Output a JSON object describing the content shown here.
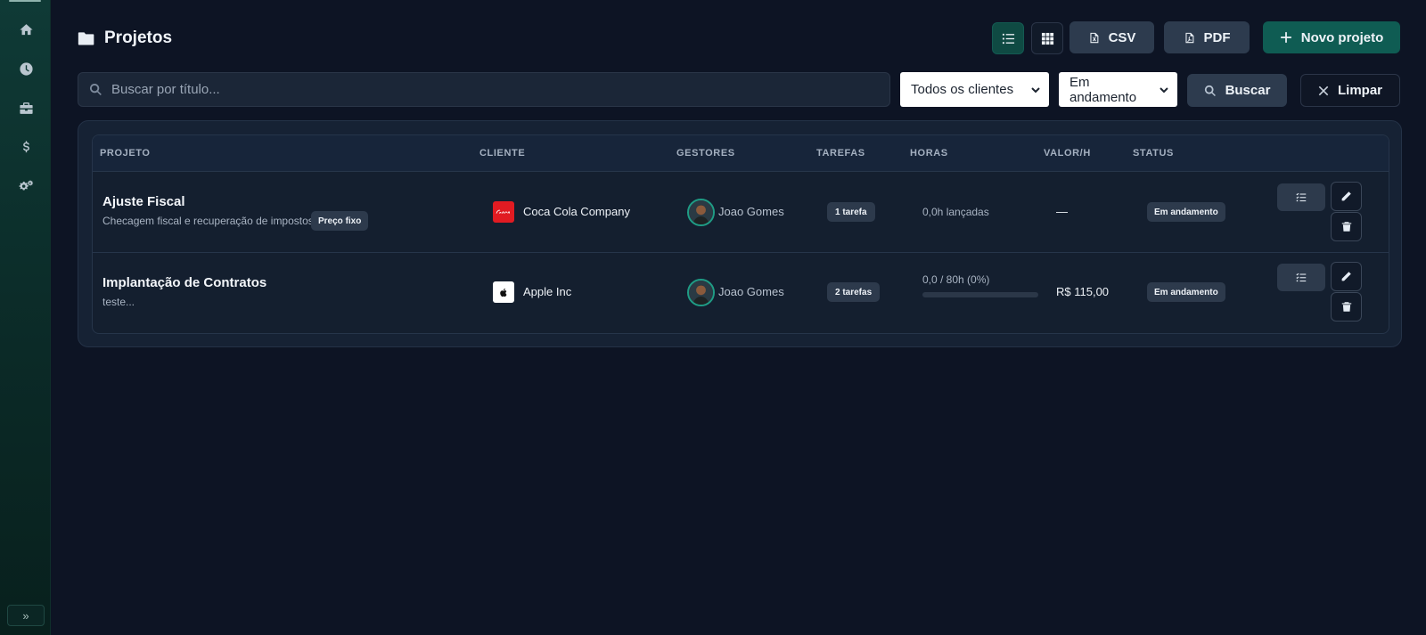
{
  "sidebar": {
    "items": [
      {
        "icon": "home-icon",
        "label": "home"
      },
      {
        "icon": "clock-icon",
        "label": "time"
      },
      {
        "icon": "briefcase-icon",
        "label": "projects"
      },
      {
        "icon": "dollar-icon",
        "label": "finance"
      },
      {
        "icon": "gears-icon",
        "label": "settings"
      }
    ],
    "toggle_label": "»"
  },
  "header": {
    "title": "Projetos",
    "csv_label": "CSV",
    "pdf_label": "PDF",
    "new_label": "Novo projeto"
  },
  "filters": {
    "search_placeholder": "Buscar por título...",
    "client_select": "Todos os clientes",
    "status_select": "Em andamento",
    "search_label": "Buscar",
    "clear_label": "Limpar"
  },
  "table": {
    "columns": [
      "PROJETO",
      "CLIENTE",
      "GESTORES",
      "TAREFAS",
      "HORAS",
      "VALOR/H",
      "STATUS"
    ],
    "rows": [
      {
        "title": "Ajuste Fiscal",
        "description": "Checagem fiscal e recuperação de impostos...",
        "tag": "Preço fixo",
        "client": "Coca Cola Company",
        "client_logo": "coca-cola-logo",
        "manager": "Joao Gomes",
        "tasks": "1 tarefa",
        "hours": "0,0h lançadas",
        "rate": "—",
        "status": "Em andamento"
      },
      {
        "title": "Implantação de Contratos",
        "description": "teste...",
        "client": "Apple Inc",
        "client_logo": "apple-logo",
        "manager": "Joao Gomes",
        "tasks": "2 tarefas",
        "hours": "0,0 / 80h (0%)",
        "hours_progress": 0,
        "rate": "R$ 115,00",
        "status": "Em andamento"
      }
    ]
  },
  "colors": {
    "accent": "#0f5c53",
    "background": "#0d1424",
    "card": "#162234"
  }
}
